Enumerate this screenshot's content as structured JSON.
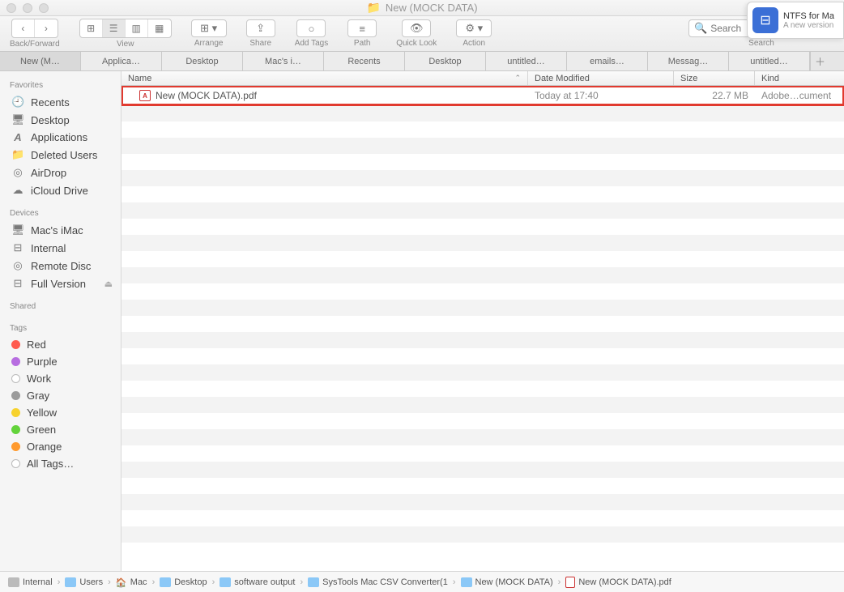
{
  "window": {
    "title": "New (MOCK DATA)"
  },
  "toolbar": {
    "back_forward": "Back/Forward",
    "view": "View",
    "arrange": "Arrange",
    "share": "Share",
    "add_tags": "Add Tags",
    "path": "Path",
    "quick_look": "Quick Look",
    "action": "Action",
    "search": "Search",
    "search_placeholder": "Search"
  },
  "notification": {
    "title": "NTFS for Ma",
    "subtitle": "A new version"
  },
  "tabs": [
    "New (M…",
    "Applica…",
    "Desktop",
    "Mac's i…",
    "Recents",
    "Desktop",
    "untitled…",
    "emails…",
    "Messag…",
    "untitled…"
  ],
  "sidebar": {
    "favorites_hdr": "Favorites",
    "favorites": [
      {
        "icon": "🕘",
        "label": "Recents"
      },
      {
        "icon": "🖥",
        "label": "Desktop"
      },
      {
        "icon": "A",
        "label": "Applications"
      },
      {
        "icon": "📁",
        "label": "Deleted Users"
      },
      {
        "icon": "◎",
        "label": "AirDrop"
      },
      {
        "icon": "☁",
        "label": "iCloud Drive"
      }
    ],
    "devices_hdr": "Devices",
    "devices": [
      {
        "icon": "🖥",
        "label": "Mac's iMac"
      },
      {
        "icon": "⊟",
        "label": "Internal"
      },
      {
        "icon": "◎",
        "label": "Remote Disc"
      },
      {
        "icon": "⊟",
        "label": "Full Version",
        "eject": true
      }
    ],
    "shared_hdr": "Shared",
    "tags_hdr": "Tags",
    "tags": [
      {
        "color": "#ff5b4f",
        "label": "Red"
      },
      {
        "color": "#b76de0",
        "label": "Purple"
      },
      {
        "color": "none",
        "label": "Work"
      },
      {
        "color": "#9b9b9b",
        "label": "Gray"
      },
      {
        "color": "#f7d22e",
        "label": "Yellow"
      },
      {
        "color": "#63d33b",
        "label": "Green"
      },
      {
        "color": "#ff9a2e",
        "label": "Orange"
      },
      {
        "color": "none",
        "label": "All Tags…"
      }
    ]
  },
  "columns": {
    "name": "Name",
    "date": "Date Modified",
    "size": "Size",
    "kind": "Kind"
  },
  "files": [
    {
      "name": "New (MOCK DATA).pdf",
      "date": "Today at 17:40",
      "size": "22.7 MB",
      "kind": "Adobe…cument"
    }
  ],
  "pathbar": [
    {
      "icon": "disk",
      "label": "Internal"
    },
    {
      "icon": "folder",
      "label": "Users"
    },
    {
      "icon": "home",
      "label": "Mac"
    },
    {
      "icon": "folder",
      "label": "Desktop"
    },
    {
      "icon": "folder",
      "label": "software output"
    },
    {
      "icon": "folder",
      "label": "SysTools Mac CSV Converter(1"
    },
    {
      "icon": "folder",
      "label": "New (MOCK DATA)"
    },
    {
      "icon": "pdf",
      "label": "New (MOCK DATA).pdf"
    }
  ]
}
